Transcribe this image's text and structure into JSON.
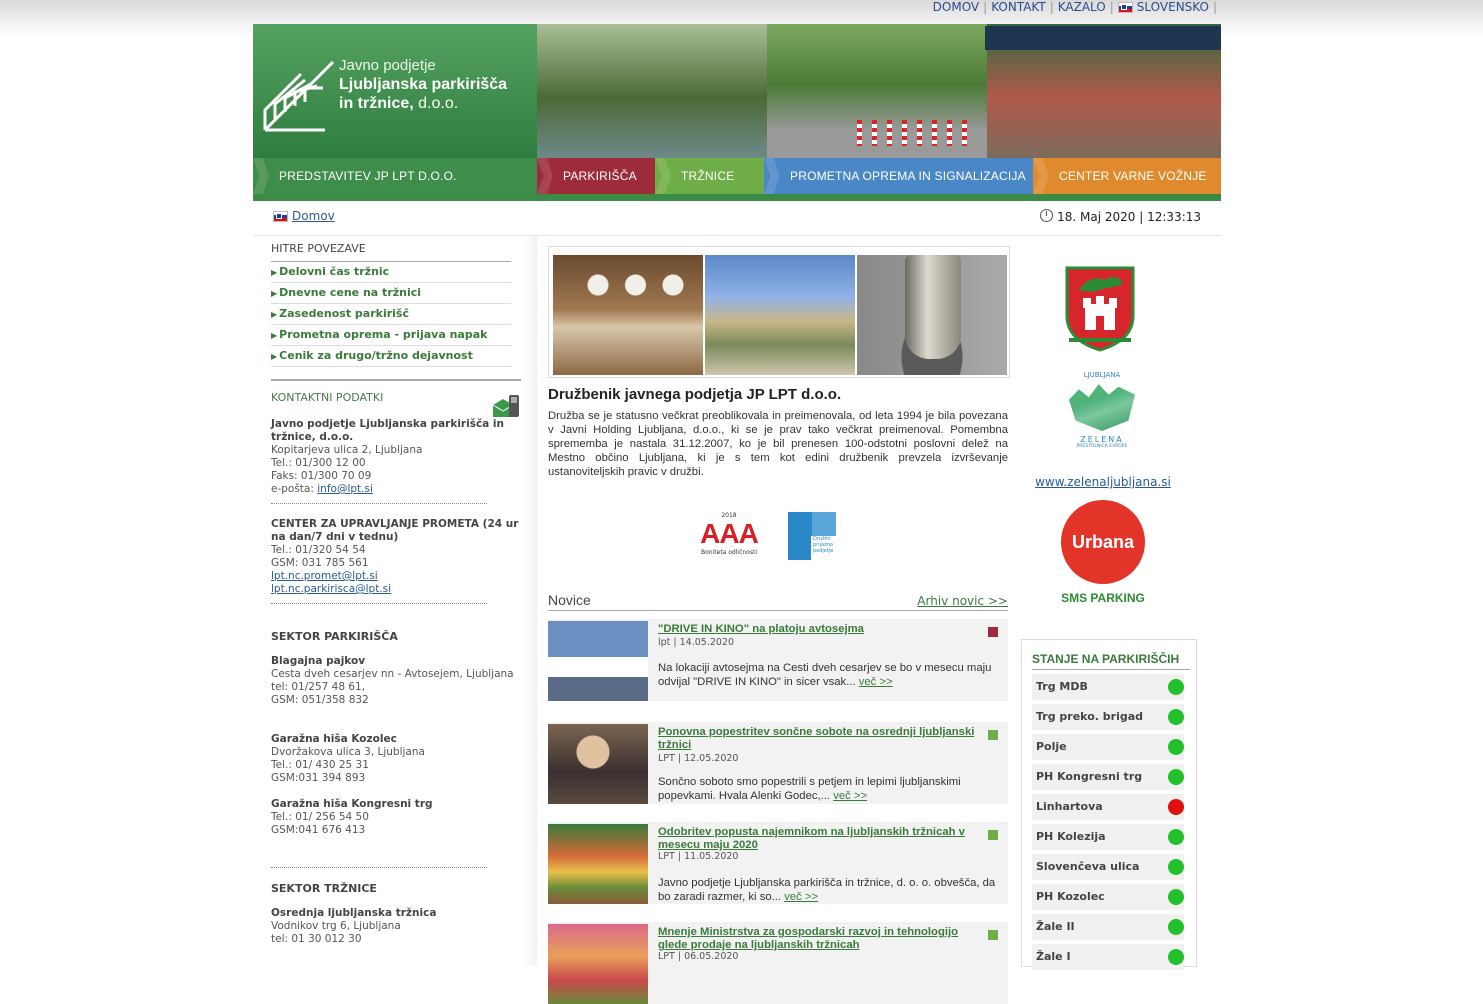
{
  "top_links": [
    "DOMOV",
    "KONTAKT",
    "KAZALO",
    "SLOVENSKO"
  ],
  "logo": {
    "line1": "Javno podjetje",
    "line2": "Ljubljanska parkirišča",
    "line3_bold": "in tržnice,",
    "line3_rest": " d.o.o."
  },
  "nav": [
    {
      "label": "PREDSTAVITEV JP LPT D.O.O.",
      "color": "#3f8d4a"
    },
    {
      "label": "PARKIRIŠČA",
      "color": "#9e2b3a"
    },
    {
      "label": "TRŽNICE",
      "color": "#6fae47"
    },
    {
      "label": "PROMETNA OPREMA IN SIGNALIZACIJA",
      "color": "#4a87c6"
    },
    {
      "label": "CENTER VARNE VOŽNJE",
      "color": "#e08a2e"
    }
  ],
  "breadcrumb": {
    "home": "Domov",
    "date": "18. Maj 2020 | 12:33:13"
  },
  "quick_links": {
    "title": "HITRE POVEZAVE",
    "items": [
      "Delovni čas tržnic",
      "Dnevne cene na tržnici",
      "Zasedenost parkirišč",
      "Prometna oprema - prijava napak",
      "Cenik za drugo/tržno dejavnost"
    ]
  },
  "contact": {
    "title": "KONTAKTNI PODATKI",
    "company": "Javno podjetje Ljubljanska parkirišča in tržnice, d.o.o.",
    "address": "Kopitarjeva ulica 2, Ljubljana",
    "tel": "Tel.: 01/300 12 00",
    "fax": "Faks: 01/300 70 09",
    "email_label": "e-pošta: ",
    "email": "info@lpt.si",
    "center_title": "CENTER ZA UPRAVLJANJE PROMETA (24 ur na dan/7 dni v tednu)",
    "center_tel": "Tel.: 01/320 54 54",
    "center_gsm": "GSM: 031 785 561",
    "center_mail1": "lpt.nc.promet@lpt.si",
    "center_mail2": "lpt.nc.parkirisca@lpt.si",
    "sektor_park": "SEKTOR PARKIRIŠČA",
    "b1_name": "Blagajna pajkov",
    "b1_addr": "Cesta dveh cesarjev nn - Avtosejem, Ljubljana",
    "b1_tel": "tel: 01/257 48 61,",
    "b1_gsm": "GSM: 051/358 832",
    "b2_name": "Garažna hiša Kozolec",
    "b2_addr": "Dvoržakova ulica 3, Ljubljana",
    "b2_tel": "Tel.: 01/ 430 25 31",
    "b2_gsm": "GSM:031 394 893",
    "b3_name": "Garažna hiša Kongresni trg",
    "b3_tel": "Tel.: 01/ 256 54 50",
    "b3_gsm": "GSM:041 676 413",
    "sektor_trz": "SEKTOR TRŽNICE",
    "t1_name": "Osrednja ljubljanska tržnica",
    "t1_addr": "Vodnikov trg 6, Ljubljana",
    "t1_tel": "tel: 01 30 012 30"
  },
  "article": {
    "title": "Družbenik javnega podjetja JP LPT d.o.o.",
    "body": "Družba se je statusno večkrat preoblikovala in preimenovala, od leta 1994 je bila povezana v Javni Holding Ljubljana, d.o.o., ki se je prav tako večkrat preimenoval. Pomembna sprememba je nastala 31.12.2007, ko je bil prenesen 100-odstotni poslovni delež na Mestno občino Ljubljana, ki je s tem kot edini družbenik prevzela izvrševanje ustanoviteljskih pravic v družbi."
  },
  "awards": {
    "aaa_year": "2018",
    "aaa": "AAA",
    "aaa_caption": "Boniteta odličnosti",
    "family": "Družini prijazno podjetje"
  },
  "news": {
    "title": "Novice",
    "archive": "Arhiv novic >>",
    "items": [
      {
        "title": "\"DRIVE IN KINO\" na platoju avtosejma",
        "meta": "lpt | 14.05.2020",
        "desc": "Na lokaciji avtosejma na Cesti dveh cesarjev se bo v mesecu maju odvijal \"DRIVE IN KINO\" in sicer vsak...",
        "more": "več >>",
        "tag_color": "#9e2b3a"
      },
      {
        "title": "Ponovna popestritev sončne sobote na osrednji ljubljanski tržnici",
        "meta": "LPT | 12.05.2020",
        "desc": "Sončno soboto smo popestrili s petjem in lepimi ljubljanskimi popevkami. Hvala Alenki Godec,...",
        "more": "več >>",
        "tag_color": "#6fae47"
      },
      {
        "title": "Odobritev popusta najemnikom na ljubljanskih tržnicah v mesecu maju 2020",
        "meta": "LPT | 11.05.2020",
        "desc": "Javno podjetje Ljubljanska parkirišča in tržnice, d. o. o. obvešča, da bo zaradi razmer, ki so...",
        "more": "več >>",
        "tag_color": "#6fae47"
      },
      {
        "title": "Mnenje Ministrstva za gospodarski razvoj in tehnologijo glede prodaje na ljubljanskih tržnicah",
        "meta": "LPT | 06.05.2020",
        "desc": "",
        "more": "",
        "tag_color": "#6fae47"
      }
    ]
  },
  "right": {
    "zelena_top": "LJUBLJANA",
    "zelena_name": "ZELENA",
    "zelena_sub": "PRESTOLNICA EVROPE",
    "zelena_link": "www.zelenaljubljana.si",
    "urbana": "Urbana",
    "sms": "SMS PARKING"
  },
  "parking": {
    "title": "STANJE NA PARKIRIŠČIH",
    "items": [
      {
        "name": "Trg MDB",
        "status": "green"
      },
      {
        "name": "Trg preko. brigad",
        "status": "green"
      },
      {
        "name": "Polje",
        "status": "green"
      },
      {
        "name": "PH Kongresni trg",
        "status": "green"
      },
      {
        "name": "Linhartova",
        "status": "red"
      },
      {
        "name": "PH Kolezija",
        "status": "green"
      },
      {
        "name": "Slovenčeva ulica",
        "status": "green"
      },
      {
        "name": "PH Kozolec",
        "status": "green"
      },
      {
        "name": "Žale II",
        "status": "green"
      },
      {
        "name": "Žale I",
        "status": "green"
      }
    ],
    "colors": {
      "green": "#22c02a",
      "red": "#e01010"
    }
  }
}
